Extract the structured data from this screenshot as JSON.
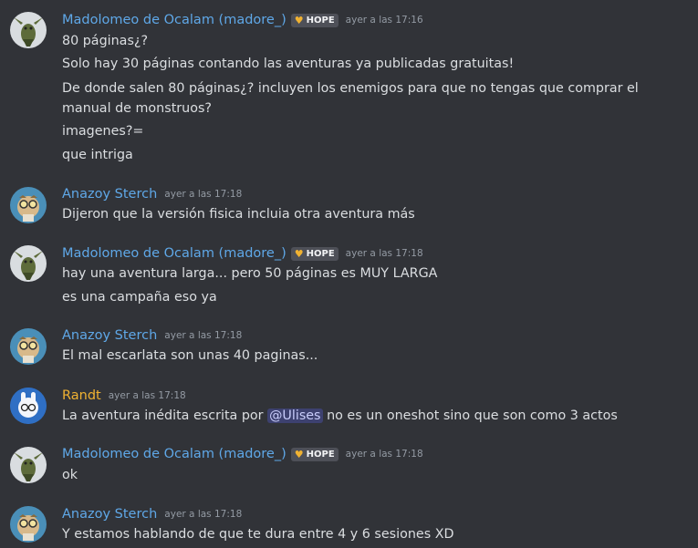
{
  "colors": {
    "background": "#313338",
    "madolomeo": "#5fa8e8",
    "anazoy": "#5fa8e8",
    "randt": "#f0b232",
    "text": "#dbdee1",
    "timestamp": "#949ba4"
  },
  "messages": [
    {
      "author": "Madolomeo de Ocalam (madore_)",
      "tag": "HOPE",
      "time": "ayer a las 17:16",
      "lines": [
        "80 páginas¿?",
        "Solo hay 30 páginas contando las aventuras ya publicadas gratuitas!",
        "De donde salen 80 páginas¿? incluyen los enemigos para que no tengas que comprar el manual de monstruos?",
        "imagenes?=",
        "que intriga"
      ]
    },
    {
      "author": "Anazoy Sterch",
      "time": "ayer a las 17:18",
      "lines": [
        "Dijeron que la versión fisica incluia otra aventura más"
      ]
    },
    {
      "author": "Madolomeo de Ocalam (madore_)",
      "tag": "HOPE",
      "time": "ayer a las 17:18",
      "lines": [
        "hay una aventura larga... pero 50 páginas es MUY LARGA",
        "es una campaña eso ya"
      ]
    },
    {
      "author": "Anazoy Sterch",
      "time": "ayer a las 17:18",
      "lines": [
        "El mal escarlata son unas 40 paginas..."
      ]
    },
    {
      "author": "Randt",
      "time": "ayer a las 17:18",
      "line_before": "La aventura inédita escrita por",
      "mention": "@Ulises",
      "line_after": "no es un oneshot sino que son como 3 actos"
    },
    {
      "author": "Madolomeo de Ocalam (madore_)",
      "tag": "HOPE",
      "time": "ayer a las 17:18",
      "lines": [
        "ok"
      ]
    },
    {
      "author": "Anazoy Sterch",
      "time": "ayer a las 17:18",
      "lines": [
        "Y estamos hablando de que te dura entre 4 y 6 sesiones XD"
      ]
    }
  ]
}
